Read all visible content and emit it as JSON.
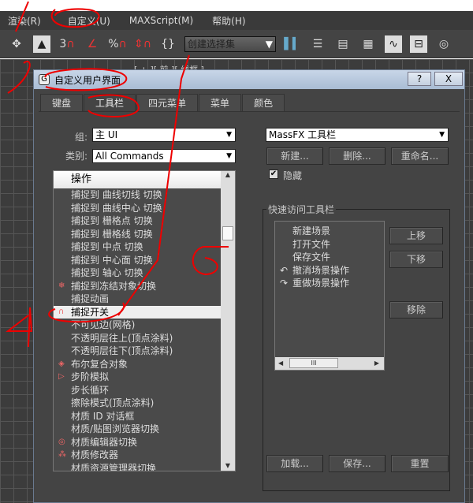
{
  "menubar": [
    "渲染(R)",
    "自定义(U)",
    "MAXScript(M)",
    "帮助(H)"
  ],
  "toolbar": {
    "selection_set": "创建选择集",
    "snap_labels": [
      "3",
      "%"
    ]
  },
  "viewport": {
    "label": "[ + ][ 前 ][ 线框 ]"
  },
  "dialog": {
    "title": "自定义用户界面",
    "help": "?",
    "close": "X",
    "tabs": [
      "键盘",
      "工具栏",
      "四元菜单",
      "菜单",
      "颜色"
    ],
    "group_label": "组:",
    "group_value": "主 UI",
    "category_label": "类别:",
    "category_value": "All Commands",
    "list_header": "操作",
    "actions": [
      {
        "label": "捕捉到 曲线切线 切换",
        "icon": ""
      },
      {
        "label": "捕捉到 曲线中心 切换",
        "icon": ""
      },
      {
        "label": "捕捉到 栅格点 切换",
        "icon": ""
      },
      {
        "label": "捕捉到 栅格线 切换",
        "icon": ""
      },
      {
        "label": "捕捉到 中点 切换",
        "icon": ""
      },
      {
        "label": "捕捉到 中心面 切换",
        "icon": ""
      },
      {
        "label": "捕捉到 轴心 切换",
        "icon": ""
      },
      {
        "label": "捕捉到冻结对象切换",
        "icon": "snap-frozen-icon"
      },
      {
        "label": "捕捉动画",
        "icon": ""
      },
      {
        "label": "捕捉开关",
        "icon": "snap-toggle-icon",
        "selected": true
      },
      {
        "label": "不可见边(网格)",
        "icon": ""
      },
      {
        "label": "不透明层往上(顶点涂料)",
        "icon": ""
      },
      {
        "label": "不透明层往下(顶点涂料)",
        "icon": ""
      },
      {
        "label": "布尔复合对象",
        "icon": "boolean-icon"
      },
      {
        "label": "步阶模拟",
        "icon": "step-simulation-icon"
      },
      {
        "label": "步长循环",
        "icon": ""
      },
      {
        "label": "擦除模式(顶点涂料)",
        "icon": ""
      },
      {
        "label": "材质 ID 对话框",
        "icon": ""
      },
      {
        "label": "材质/贴图浏览器切换",
        "icon": ""
      },
      {
        "label": "材质编辑器切换",
        "icon": "material-editor-icon"
      },
      {
        "label": "材质修改器",
        "icon": "material-modifier-icon"
      },
      {
        "label": "材质资源管理器切换",
        "icon": ""
      }
    ],
    "toolbar_select": "MassFX 工具栏",
    "new_btn": "新建...",
    "delete_btn": "删除...",
    "rename_btn": "重命名...",
    "hide_label": "隐藏",
    "hide_checked": true,
    "quick_access_label": "快速访问工具栏",
    "quick_items": [
      {
        "label": "新建场景",
        "icon": ""
      },
      {
        "label": "打开文件",
        "icon": ""
      },
      {
        "label": "保存文件",
        "icon": ""
      },
      {
        "label": "撤消场景操作",
        "icon": "undo-icon"
      },
      {
        "label": "重做场景操作",
        "icon": "redo-icon"
      }
    ],
    "move_up": "上移",
    "move_down": "下移",
    "remove": "移除",
    "load_btn": "加载...",
    "save_btn": "保存...",
    "reset_btn": "重置"
  }
}
